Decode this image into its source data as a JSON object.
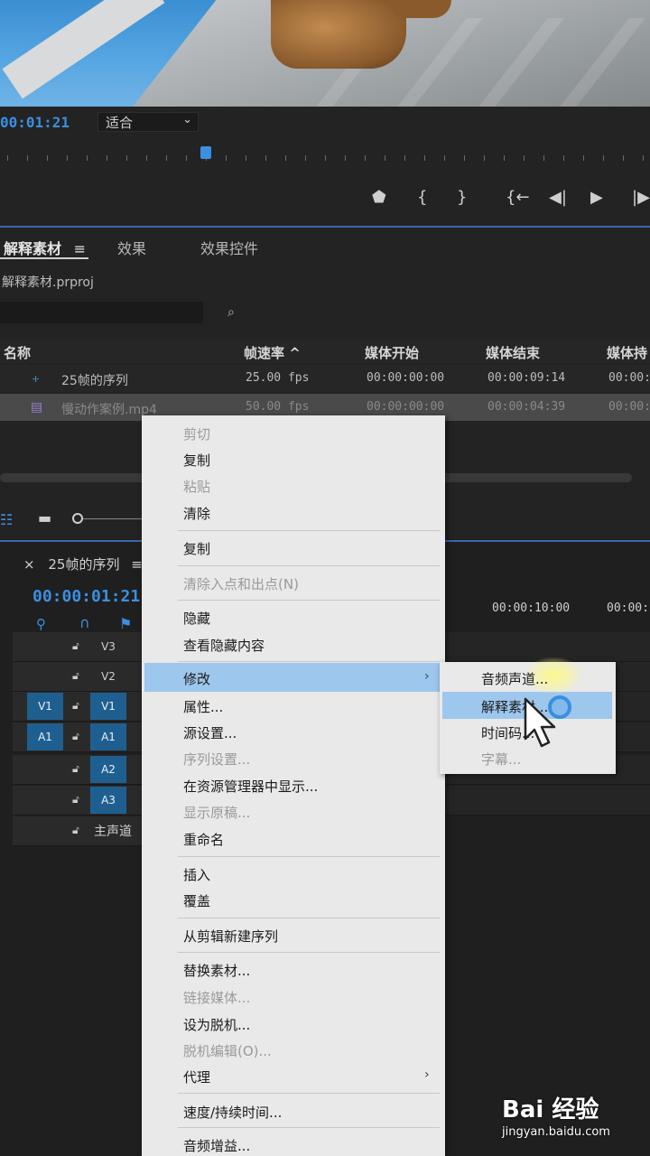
{
  "monitor": {
    "timecode": "00:01:21",
    "fit_value": "适合",
    "fit_arrow": "⌄",
    "controls": [
      "⬟",
      "{",
      "}",
      "{←",
      "◀|",
      "▶",
      "|▶"
    ]
  },
  "project_panel": {
    "tabs": [
      {
        "label": "解释素材",
        "active": true
      },
      {
        "label": "效果",
        "active": false
      },
      {
        "label": "效果控件",
        "active": false
      }
    ],
    "menu_glyph": "≡",
    "file_name": "解释素材.prproj",
    "columns": [
      "名称",
      "帧速率 ^",
      "媒体开始",
      "媒体结束",
      "媒体持"
    ],
    "rows": [
      {
        "name": "25帧的序列",
        "fps": "25.00 fps",
        "start": "00:00:00:00",
        "end": "00:00:09:14",
        "dur": "00:00:"
      },
      {
        "name": "慢动作案例.mp4",
        "fps": "50.00 fps",
        "start": "00:00:00:00",
        "end": "00:00:04:39",
        "dur": "00:00:"
      }
    ]
  },
  "timeline": {
    "tab_close": "×",
    "tab_label": "25帧的序列",
    "timecode": "00:00:01:21",
    "ruler_tc1": "00:00:10:00",
    "ruler_tc2": "00:00:1",
    "tracks": [
      {
        "src": "",
        "tgt": "V3"
      },
      {
        "src": "",
        "tgt": "V2"
      },
      {
        "src": "V1",
        "tgt": "V1"
      },
      {
        "src": "A1",
        "tgt": "A1"
      },
      {
        "src": "",
        "tgt": "A2"
      },
      {
        "src": "",
        "tgt": "A3"
      }
    ],
    "master_label": "主声道"
  },
  "context_menu": {
    "items": [
      {
        "label": "剪切",
        "disabled": true
      },
      {
        "label": "复制",
        "disabled": false
      },
      {
        "label": "粘贴",
        "disabled": true
      },
      {
        "label": "清除",
        "disabled": false
      },
      {
        "label": "复制",
        "disabled": false
      },
      {
        "label": "清除入点和出点(N)",
        "disabled": true
      },
      {
        "label": "隐藏",
        "disabled": false
      },
      {
        "label": "查看隐藏内容",
        "disabled": false
      },
      {
        "label": "修改",
        "disabled": false
      },
      {
        "label": "属性...",
        "disabled": false
      },
      {
        "label": "源设置...",
        "disabled": false
      },
      {
        "label": "序列设置...",
        "disabled": true
      },
      {
        "label": "在资源管理器中显示...",
        "disabled": false
      },
      {
        "label": "显示原稿...",
        "disabled": true
      },
      {
        "label": "重命名",
        "disabled": false
      },
      {
        "label": "插入",
        "disabled": false
      },
      {
        "label": "覆盖",
        "disabled": false
      },
      {
        "label": "从剪辑新建序列",
        "disabled": false
      },
      {
        "label": "替换素材...",
        "disabled": false
      },
      {
        "label": "链接媒体...",
        "disabled": true
      },
      {
        "label": "设为脱机...",
        "disabled": false
      },
      {
        "label": "脱机编辑(O)...",
        "disabled": true
      },
      {
        "label": "代理",
        "disabled": false
      },
      {
        "label": "速度/持续时间...",
        "disabled": false
      },
      {
        "label": "音频增益...",
        "disabled": false
      }
    ],
    "submenu_arrow": "›"
  },
  "submenu": {
    "items": [
      {
        "label": "音频声道...",
        "disabled": false
      },
      {
        "label": "解释素材...",
        "disabled": false
      },
      {
        "label": "时间码...",
        "disabled": false
      },
      {
        "label": "字幕...",
        "disabled": true
      }
    ]
  },
  "watermark": {
    "logo": "Bai 经验",
    "url": "jingyan.baidu.com"
  },
  "colors": {
    "accent_blue": "#3b8fe0",
    "highlight": "#9dc7ec",
    "track_on": "#1f5f8f"
  }
}
